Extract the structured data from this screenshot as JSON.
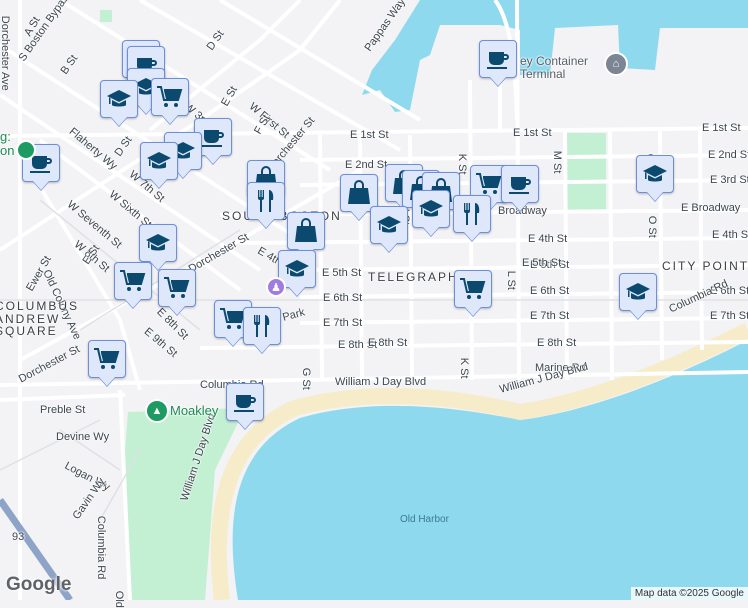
{
  "colors": {
    "water": "#8fd9ef",
    "park": "#c3efd3",
    "sand": "#f6ecc9",
    "marker_bg": "#dfe8fb",
    "marker_icon": "#0b4a6e"
  },
  "labels": {
    "a_st": "A St",
    "dorchester_ave_n": "Dorchester Ave",
    "s_boston_bypass": "S Boston Bypass",
    "b_st": "B St",
    "d_st_n": "D St",
    "pappas_way": "Pappas Way",
    "w_first_st": "W First St",
    "e_st": "E St",
    "f_st": "F St",
    "w_3rd": "W 3rd",
    "flaherty_wy": "Flaherty Wy",
    "d_st": "D St",
    "w_7th": "W 7th St",
    "dorchester_st": "Dorchester St",
    "e_2nd_st_w": "E 2nd St",
    "w_seventh_st": "W Seventh St",
    "w_sixth_st": "W Sixth St",
    "w_8th_st": "W 8th St",
    "e_st_s": "E St",
    "old_colony_ave": "Old Colony Ave",
    "ewer_st": "Ewer St",
    "south_boston": "SOUTH BOSTON",
    "e_4th_w": "E 4th",
    "dorchester_st_s": "Dorchester St",
    "e_5th_st_w": "E 5th St",
    "e_6th_st_w": "E 6th St",
    "e_7th_st_w": "E 7th St",
    "e_8th_st_w": "E 8th St",
    "e_9th_st": "E 9th St",
    "e_8th_st": "E 8th St",
    "park": "Park",
    "columbus_square": "COLUMBUS\nANDREW\nSQUARE",
    "dorchester_st_sw": "Dorchester St",
    "preble_st": "Preble St",
    "devine_wy": "Devine Wy",
    "logan_wy": "Logan Wy",
    "gavin_wy": "Gavin Wy",
    "columbia_rd": "Columbia Rd",
    "dorchester_ave_s": "Dorchester Ave",
    "old_colony": "Old",
    "william_j_day_blvd_v": "William J Day Blvd",
    "columbia_rd_n": "Columbia Rd",
    "william_j_day_blvd": "William J Day Blvd",
    "g_st": "G St",
    "moakley": "Moakley",
    "telegraph": "TELEGRAPH",
    "e_1st_st": "E 1st St",
    "e_1st_st_e": "E 1st St",
    "e_2nd_st": "E 2nd St",
    "e_3rd_st": "E 3rd St",
    "broadway": "Broadway",
    "e_broadway": "E Broadway",
    "e_4th_st": "E 4th St",
    "e_4th_st_e": "E 4th St",
    "e_5th_st": "E 5th St",
    "e_5th_st_e": "E 5th St",
    "city_point": "CITY POINT",
    "e_6th_st": "E 6th St",
    "e_6th_st_e": "E 6th St",
    "e_7th_st": "E 7th St",
    "e_7th_st_e": "E 7th St",
    "e_8th_st_c": "E 8th St",
    "e_8th_st_e": "E 8th St",
    "marine_rd": "Marine Rd",
    "k_st": "K St",
    "k_st_s": "K St",
    "l_st": "L St",
    "m_st": "M St",
    "o_st": "O St",
    "o_st_s": "O St",
    "i_st": "I St",
    "columbia_rd_e": "Columbia Rd",
    "william_j_day_blvd_e": "William J Day Blvd",
    "old_harbor": "Old Harbor",
    "container_terminal": "ey Container\nTerminal",
    "i93": "93",
    "g_label": "g:\non"
  },
  "markers": [
    "coffee",
    "coffee",
    "graduation-cap",
    "shopping-cart",
    "graduation-cap",
    "coffee",
    "graduation-cap",
    "graduation-cap",
    "coffee",
    "shopping-bag",
    "fork-knife",
    "shopping-bag",
    "shopping-bag",
    "graduation-cap",
    "graduation-cap",
    "shopping-cart",
    "shopping-cart",
    "shopping-cart",
    "fork-knife",
    "shopping-cart",
    "coffee",
    "shopping-bag",
    "shopping-bag",
    "graduation-cap",
    "shopping-bag",
    "shopping-cart",
    "coffee",
    "fork-knife",
    "graduation-cap",
    "coffee",
    "graduation-cap",
    "shopping-cart",
    "graduation-cap"
  ],
  "footer": {
    "google": "Google",
    "attribution": "Map data ©2025 Google"
  }
}
